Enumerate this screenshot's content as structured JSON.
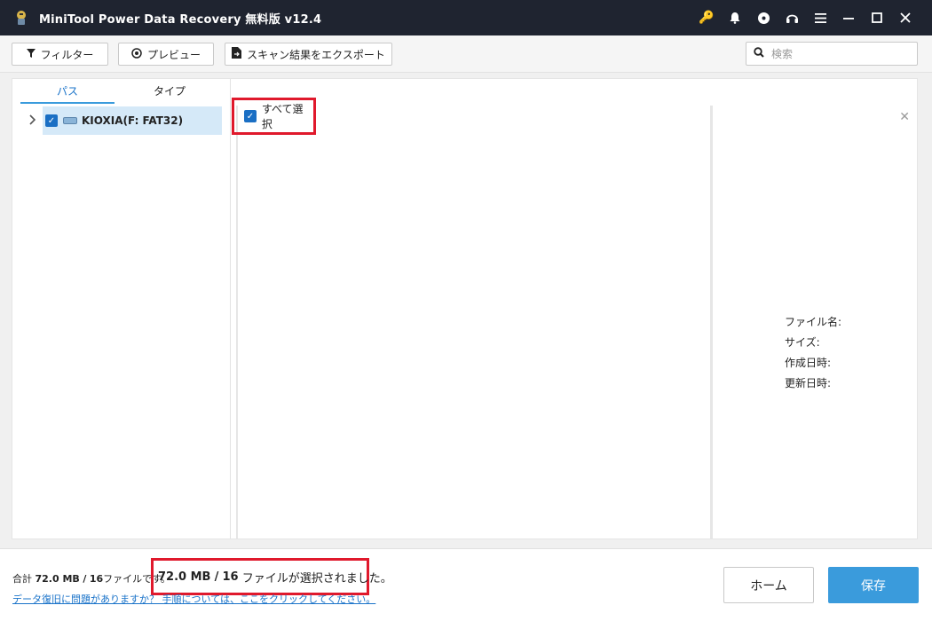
{
  "window": {
    "title": "MiniTool Power Data Recovery 無料版 v12.4",
    "controls": [
      {
        "name": "key-icon",
        "glyph": "🔑"
      },
      {
        "name": "bell-icon",
        "glyph": "🔔"
      },
      {
        "name": "disc-icon",
        "glyph": "◉"
      },
      {
        "name": "headset-icon",
        "glyph": "🎧"
      },
      {
        "name": "menu-icon",
        "glyph": "≡"
      },
      {
        "name": "minimize-icon",
        "glyph": "—"
      },
      {
        "name": "maximize-icon",
        "glyph": "☐"
      },
      {
        "name": "close-icon",
        "glyph": "✕"
      }
    ]
  },
  "toolbar": {
    "filter_label": "フィルター",
    "preview_label": "プレビュー",
    "export_label": "スキャン結果をエクスポート",
    "search_placeholder": "検索"
  },
  "tabs": {
    "path": "パス",
    "type": "タイプ"
  },
  "tree": {
    "drive_label": "KIOXIA(F: FAT32)",
    "checked": true
  },
  "list": {
    "select_all_label": "すべて選択"
  },
  "preview": {
    "filename_label": "ファイル名:",
    "size_label": "サイズ:",
    "created_label": "作成日時:",
    "modified_label": "更新日時:"
  },
  "footer": {
    "total_prefix": "合計",
    "total_size": "72.0 MB",
    "total_sep": "/",
    "total_count": "16",
    "total_suffix": "ファイルです。",
    "selected_size": "72.0 MB",
    "selected_sep": "/",
    "selected_count": "16",
    "selected_suffix": "ファイルが選択されました。",
    "help_link": "データ復旧に問題がありますか？ 手順については、ここをクリックしてください。",
    "home_label": "ホーム",
    "save_label": "保存"
  },
  "colors": {
    "titlebar_bg": "#1f2430",
    "accent": "#3a9bdc",
    "highlight_box": "#e0192c",
    "selected_row": "#d5e9f8"
  }
}
